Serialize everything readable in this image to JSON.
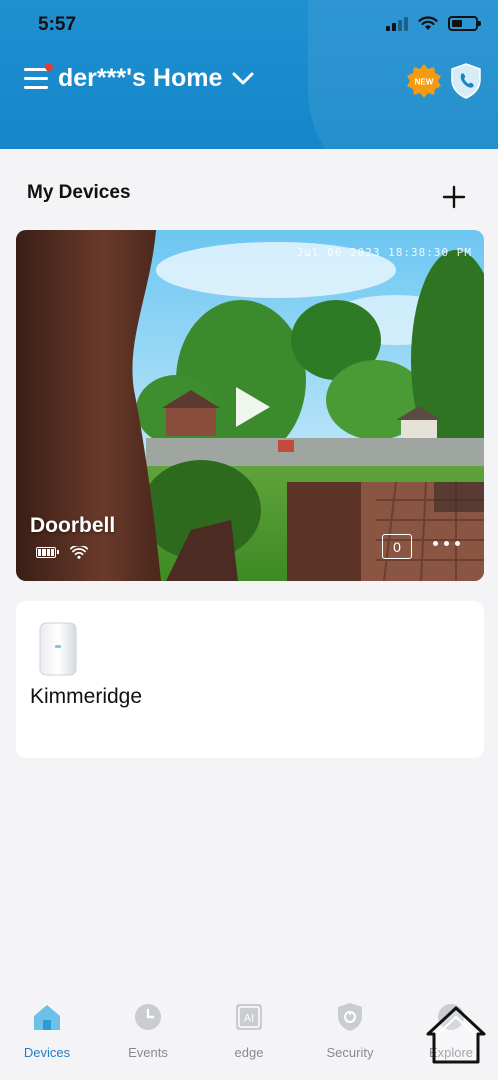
{
  "status_bar": {
    "time": "5:57"
  },
  "header": {
    "home_title": "der***'s Home",
    "new_badge": "NEW"
  },
  "devices_section": {
    "title": "My Devices"
  },
  "doorbell_card": {
    "name": "Doorbell",
    "timestamp": "Jul 06 2023 18:38:30 PM",
    "event_count": "0"
  },
  "base_card": {
    "name": "Kimmeridge"
  },
  "tabbar": {
    "tabs": [
      {
        "label": "Devices",
        "icon": "house-icon",
        "active": true
      },
      {
        "label": "Events",
        "icon": "clock-icon",
        "active": false
      },
      {
        "label": "edge",
        "icon": "ai-icon",
        "active": false
      },
      {
        "label": "Security",
        "icon": "shield-icon",
        "active": false
      },
      {
        "label": "Explore",
        "icon": "compass-icon",
        "active": false
      }
    ]
  },
  "colors": {
    "header_blue": "#1587c9",
    "accent_blue": "#1e7fc4",
    "badge_orange": "#f59b12",
    "notify_red": "#e53935"
  }
}
